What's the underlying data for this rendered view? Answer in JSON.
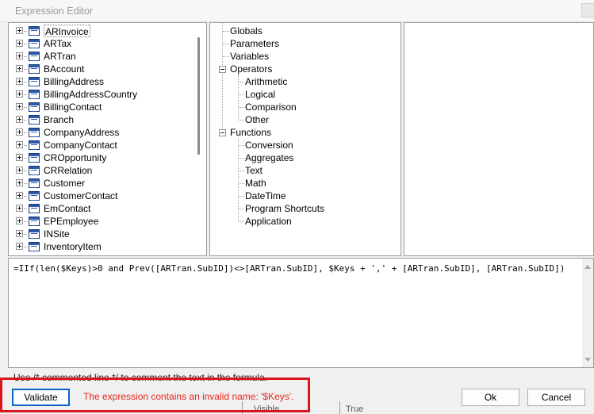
{
  "window": {
    "title": "Expression Editor"
  },
  "fields": [
    "ARInvoice",
    "ARTax",
    "ARTran",
    "BAccount",
    "BillingAddress",
    "BillingAddressCountry",
    "BillingContact",
    "Branch",
    "CompanyAddress",
    "CompanyContact",
    "CROpportunity",
    "CRRelation",
    "Customer",
    "CustomerContact",
    "EmContact",
    "EPEmployee",
    "INSite",
    "InventoryItem"
  ],
  "operators_tree": {
    "globals": "Globals",
    "parameters": "Parameters",
    "variables": "Variables",
    "operators": {
      "label": "Operators",
      "children": [
        "Arithmetic",
        "Logical",
        "Comparison",
        "Other"
      ]
    },
    "functions": {
      "label": "Functions",
      "children": [
        "Conversion",
        "Aggregates",
        "Text",
        "Math",
        "DateTime",
        "Program Shortcuts",
        "Application"
      ]
    }
  },
  "expression": "=IIf(len($Keys)>0 and Prev([ARTran.SubID])<>[ARTran.SubID], $Keys + ',' + [ARTran.SubID], [ARTran.SubID])",
  "hint": "Use /* commented line */ to comment the text in the formula.",
  "buttons": {
    "validate": "Validate",
    "ok": "Ok",
    "cancel": "Cancel"
  },
  "error_message": "The expression contains an invalid name: '$Keys'.",
  "behind": {
    "visible_label": "Visible",
    "true_label": "True"
  },
  "colors": {
    "error_text": "#e8281e",
    "highlight_border": "#d8161c",
    "focus_border": "#0a64c8"
  }
}
